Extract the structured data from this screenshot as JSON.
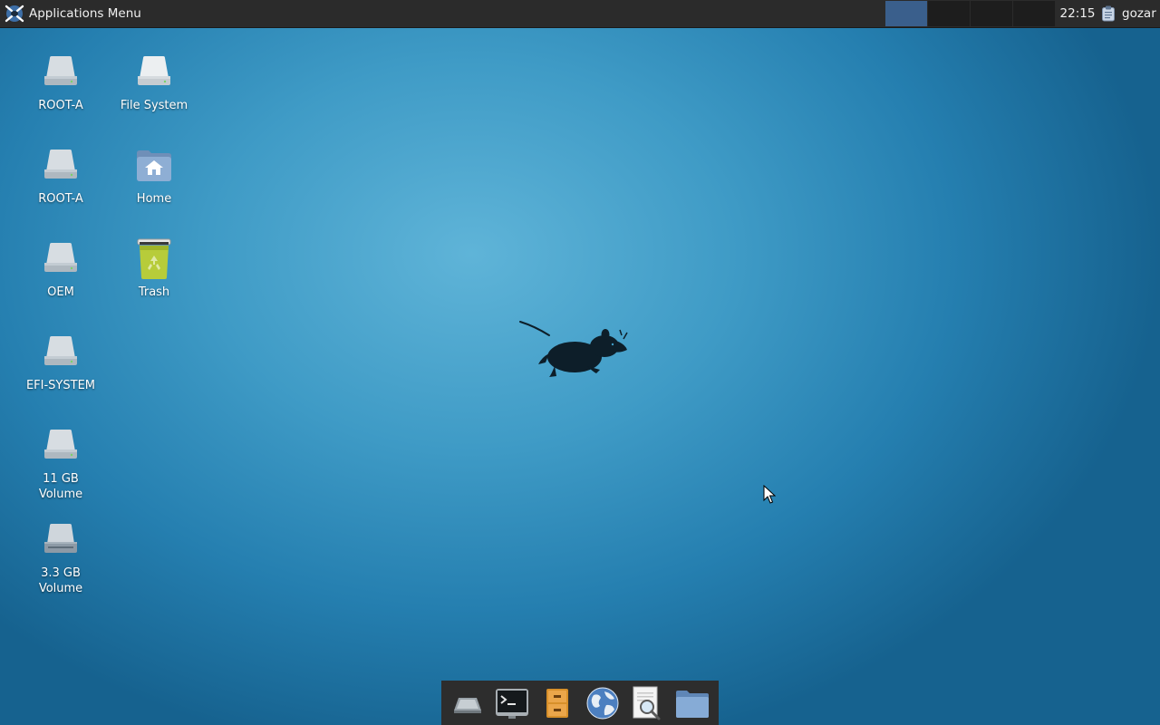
{
  "panel": {
    "apps_menu_label": "Applications Menu",
    "clock": "22:15",
    "user": "gozar",
    "workspaces": [
      "Workspace 1",
      "Workspace 2",
      "Workspace 3",
      "Workspace 4"
    ],
    "active_workspace": 1
  },
  "desktop": {
    "icons": [
      {
        "label": "ROOT-A",
        "icon": "drive-harddisk-icon"
      },
      {
        "label": "File System",
        "icon": "drive-harddisk-icon"
      },
      {
        "label": "ROOT-A",
        "icon": "drive-harddisk-icon"
      },
      {
        "label": "Home",
        "icon": "home-folder-icon"
      },
      {
        "label": "OEM",
        "icon": "drive-harddisk-icon"
      },
      {
        "label": "Trash",
        "icon": "trash-icon"
      },
      {
        "label": "EFI-SYSTEM",
        "icon": "drive-harddisk-icon"
      },
      {
        "label": "11 GB Volume",
        "icon": "drive-harddisk-icon"
      },
      {
        "label": "3.3 GB Volume",
        "icon": "drive-removable-icon"
      }
    ]
  },
  "dock": {
    "items": [
      {
        "name": "show-desktop",
        "icon": "show-desktop-icon"
      },
      {
        "name": "terminal",
        "icon": "terminal-icon"
      },
      {
        "name": "file-manager-cabinet",
        "icon": "cabinet-icon"
      },
      {
        "name": "web-browser",
        "icon": "globe-icon"
      },
      {
        "name": "app-finder",
        "icon": "search-document-icon"
      },
      {
        "name": "folder",
        "icon": "folder-icon"
      }
    ]
  },
  "colors": {
    "panel_bg": "#2b2b2b",
    "active_workspace": "#3a5f8c",
    "desktop_center": "#5fb4d8",
    "desktop_edge": "#16628f"
  }
}
